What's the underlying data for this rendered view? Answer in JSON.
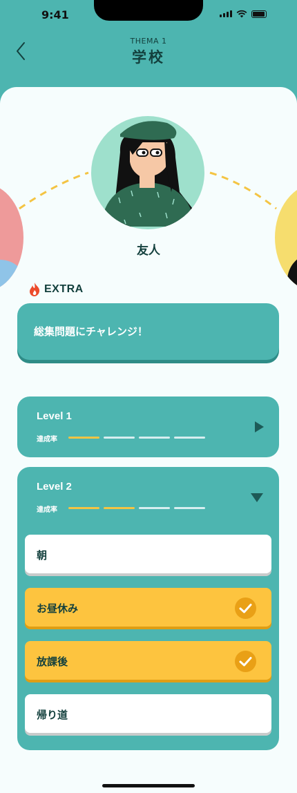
{
  "status_bar": {
    "time": "9:41"
  },
  "header": {
    "subtitle": "THEMA 1",
    "title": "学校"
  },
  "character": {
    "name": "友人"
  },
  "extra": {
    "label": "EXTRA",
    "challenge": "総集問題にチャレンジ！"
  },
  "levels": [
    {
      "title": "Level 1",
      "progress_label": "達成率",
      "progress": 0.25,
      "segments_done": 1,
      "segments_total": 4,
      "expanded": false
    },
    {
      "title": "Level 2",
      "progress_label": "達成率",
      "progress": 0.5,
      "segments_done": 2,
      "segments_total": 4,
      "expanded": true,
      "lessons": [
        {
          "label": "朝",
          "completed": false
        },
        {
          "label": "お昼休み",
          "completed": true
        },
        {
          "label": "放課後",
          "completed": true
        },
        {
          "label": "帰り道",
          "completed": false
        }
      ]
    }
  ],
  "colors": {
    "teal": "#4db5b0",
    "yellow": "#fdc43f",
    "dark_text": "#13403d",
    "sheet": "#f6fdfd"
  },
  "icons": [
    "back-chevron-icon",
    "fire-icon",
    "play-arrow-icon",
    "caret-down-icon",
    "checkmark-icon"
  ]
}
